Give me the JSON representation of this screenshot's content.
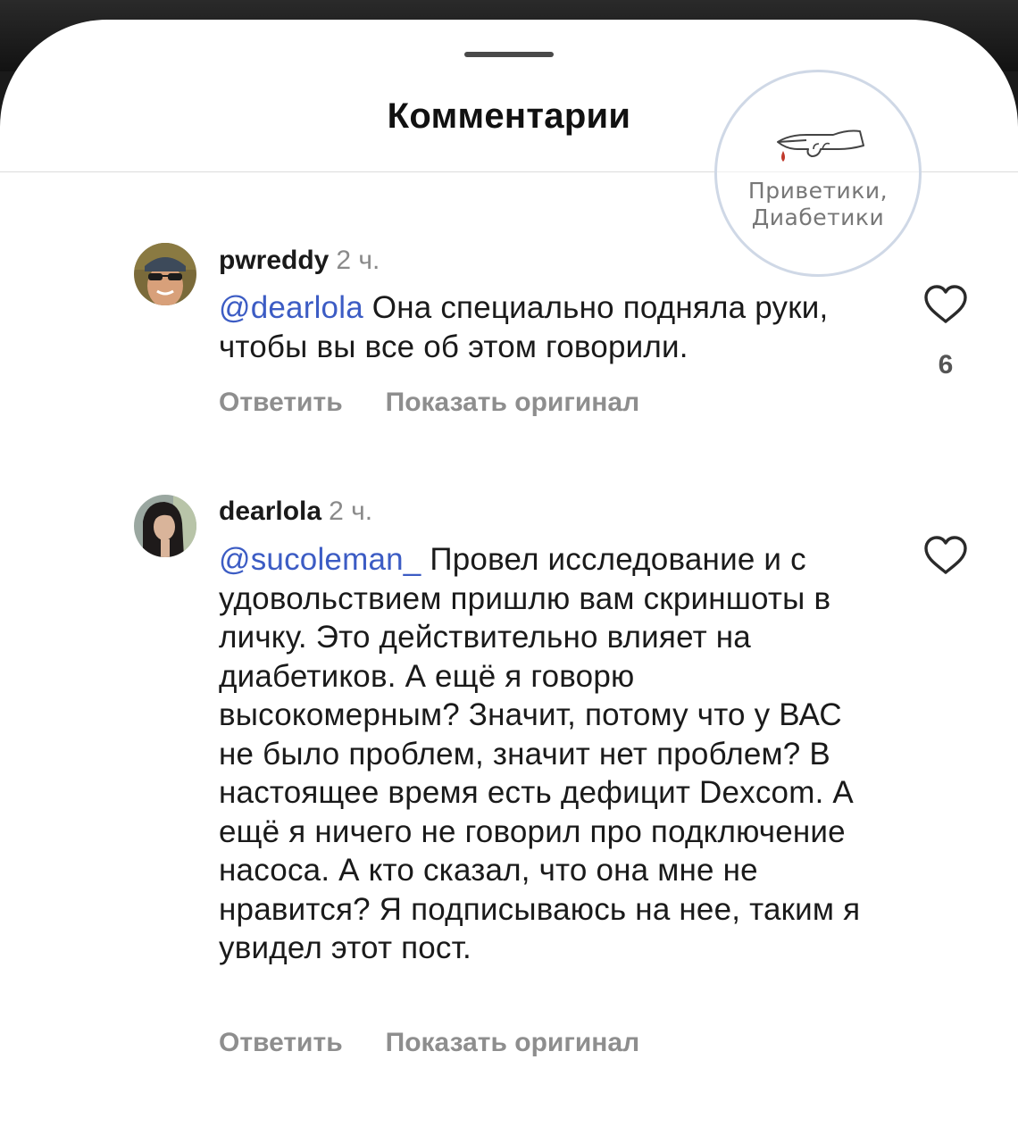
{
  "header": {
    "title": "Комментарии"
  },
  "watermark": {
    "line1": "Приветики,",
    "line2": "Диабетики"
  },
  "comments": [
    {
      "username": "pwreddy",
      "time": "2 ч.",
      "mention": "@dearlola",
      "text": " Она специально подняла руки, чтобы вы все об этом говорили.",
      "reply_label": "Ответить",
      "show_original_label": "Показать оригинал",
      "likes": "6"
    },
    {
      "username": "dearlola",
      "time": "2 ч.",
      "mention": "@sucoleman_",
      "text": " Провел исследование и с удовольствием пришлю вам скриншоты в личку. Это действительно влияет на диабетиков. А ещё я говорю высокомерным? Значит, потому что у ВАС не было проблем, значит нет проблем? В настоящее время есть дефицит Dexcom. А ещё я ничего не говорил про подключение насоса. А кто сказал, что она мне не нравится? Я подписываюсь на нее, таким я увидел этот пост.",
      "reply_label": "Ответить",
      "show_original_label": "Показать оригинал",
      "likes": ""
    }
  ],
  "icons": {
    "like": "heart-outline-icon",
    "watermark": "pointing-hand-drop-icon"
  },
  "colors": {
    "mention": "#3c5cc4",
    "muted": "#8e8e8e",
    "text": "#1a1a1a"
  }
}
